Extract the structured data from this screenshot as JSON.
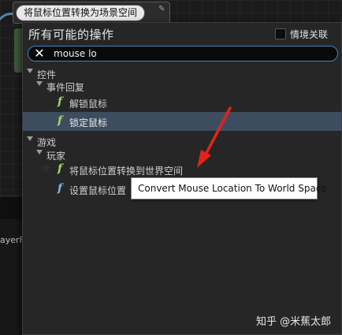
{
  "background": {
    "node_title": "将鼠标位置转换为场景空间",
    "partial_label": "ayerF"
  },
  "menu": {
    "title": "所有可能的操作",
    "context_sensitive_label": "情境关联",
    "context_sensitive_checked": false,
    "search": {
      "value": "mouse lo"
    },
    "tree": [
      {
        "label": "控件",
        "level": 0
      },
      {
        "label": "事件回复",
        "level": 1
      },
      {
        "label": "解锁鼠标",
        "level": 2,
        "icon": "function-icon"
      },
      {
        "label": "锁定鼠标",
        "level": 2,
        "icon": "function-icon",
        "selected": true
      },
      {
        "label": "游戏",
        "level": 0
      },
      {
        "label": "玩家",
        "level": 1
      },
      {
        "label": "将鼠标位置转换到世界空间",
        "level": 2,
        "icon": "function-icon"
      },
      {
        "label": "设置鼠标位置",
        "level": 2,
        "icon": "function-icon"
      }
    ]
  },
  "tooltip": {
    "text": "Convert Mouse Location To World Space"
  },
  "annotation": {
    "arrow_color": "#e0241b"
  },
  "watermark": {
    "text": "知乎 @米蕉太郎"
  }
}
